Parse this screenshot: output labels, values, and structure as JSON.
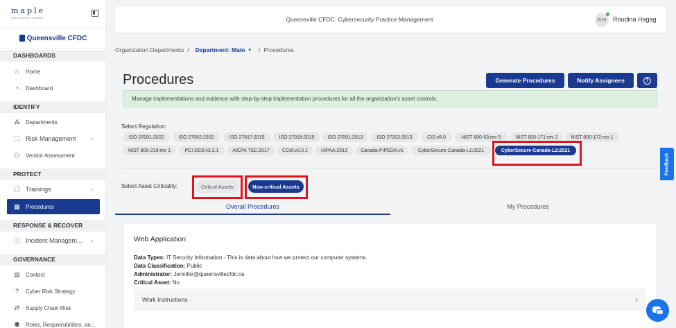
{
  "app": {
    "logo": "maple",
    "logo_sub": "cyber assurance solutions"
  },
  "sidebar": {
    "org_name": "Queensville CFDC",
    "sections": {
      "dashboards": "DASHBOARDS",
      "identify": "IDENTIFY",
      "protect": "PROTECT",
      "respond": "RESPONSE & RECOVER",
      "governance": "GOVERNANCE"
    },
    "items": {
      "home": "Home",
      "dashboard": "Dashboard",
      "departments": "Departments",
      "risk": "Risk Management",
      "vendor": "Vendor Assessment",
      "trainings": "Trainings",
      "procedures": "Procedures",
      "incident": "Incident Managem...",
      "context": "Context",
      "cyber_risk": "Cyber Risk Strategy",
      "supply": "Supply Chain Risk",
      "roles": "Roles, Responsibilities, an..."
    }
  },
  "header": {
    "title": "Queensville CFDC: Cybersecurity Practice Management",
    "initials": "R H",
    "user": "Roudina Hagag"
  },
  "breadcrumb": {
    "root": "Organization Departments",
    "sep": "/",
    "dept": "Department: Main",
    "caret": "▾",
    "current": "Procedures"
  },
  "page": {
    "title": "Procedures",
    "btn_generate": "Generate Procedures",
    "btn_notify": "Notify Assignees",
    "help": "?",
    "banner": "Manage implementations and evidence with step-by-step implementation procedures for all the organization's asset controls."
  },
  "regulation": {
    "label": "Select Regulation:",
    "row1": [
      "ISO 27001:2022",
      "ISO 27002:2022",
      "ISO 27017:2015",
      "ISO 27018:2019",
      "ISO 27001:2013",
      "ISO 27002:2013",
      "CIS:v8.0",
      "NIST 800-53:rev 5",
      "NIST 800-171:rev 2",
      "NIST 800-172:rev 1"
    ],
    "row2": [
      "NIST 800-218:rev 1",
      "PCI DSS:v3.2.1",
      "AICPA TSC:2017",
      "CCM:v3.0.1",
      "HIPAA:2013",
      "Canada-PIPEDA:v1",
      "CyberSecure-Canada-L1:2021",
      "CyberSecure-Canada-L2:2021"
    ]
  },
  "criticality": {
    "label": "Select Asset Criticality:",
    "critical": "Critical Assets",
    "noncritical": "Non-critical Assets"
  },
  "tabs": {
    "overall": "Overall Procedures",
    "mine": "My Procedures"
  },
  "card": {
    "title": "Web Application",
    "data_types_k": "Data Types:",
    "data_types_v": "IT Security Information - This is data about how we protect our computer systems.",
    "classification_k": "Data Classification:",
    "classification_v": "Public",
    "admin_k": "Administrator:",
    "admin_v": "Jennifer@queensvillecfdc.ca",
    "critical_k": "Critical Asset:",
    "critical_v": "No",
    "work_instructions": "Work Instructions"
  },
  "feedback": "Feedback",
  "colors": {
    "primary": "#1a3a8f",
    "highlight": "#e0141e",
    "banner": "#dcefe1",
    "accent": "#1a73e8"
  }
}
